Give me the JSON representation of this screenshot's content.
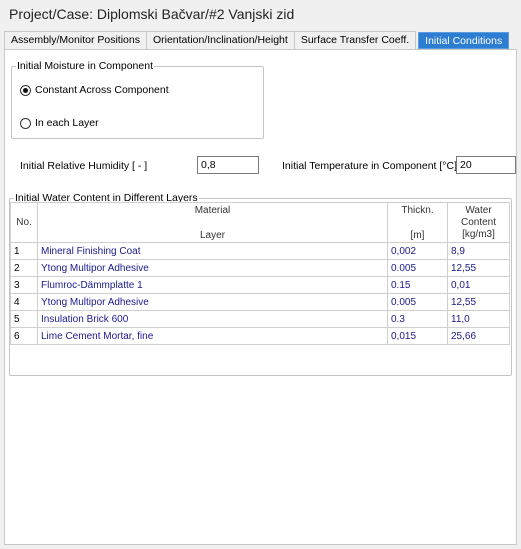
{
  "title": "Project/Case:  Diplomski Bačvar/#2 Vanjski zid",
  "tabs": [
    {
      "label": "Assembly/Monitor Positions",
      "active": false
    },
    {
      "label": "Orientation/Inclination/Height",
      "active": false
    },
    {
      "label": "Surface Transfer Coeff.",
      "active": false
    },
    {
      "label": "Initial Conditions",
      "active": true
    }
  ],
  "moisture_group": {
    "legend": "Initial Moisture in Component",
    "options": [
      {
        "label": "Constant Across Component",
        "checked": true
      },
      {
        "label": "In each Layer",
        "checked": false
      }
    ]
  },
  "fields": {
    "rh_label": "Initial Relative Humidity [ - ]",
    "rh_value": "0,8",
    "temp_label": "Initial Temperature in Component [°C]",
    "temp_value": "20"
  },
  "water_group": {
    "legend": "Initial Water Content in Different Layers",
    "headers": {
      "no": "No.",
      "material_top": "Material",
      "material_bottom": "Layer",
      "thickn_top": "Thickn.",
      "thickn_bottom": "[m]",
      "water_line1": "Water",
      "water_line2": "Content",
      "water_line3": "[kg/m3]"
    },
    "rows": [
      {
        "no": "1",
        "material": "Mineral Finishing Coat",
        "thickness": "0,002",
        "water": "8,9"
      },
      {
        "no": "2",
        "material": "Ytong Multipor Adhesive",
        "thickness": "0.005",
        "water": "12,55"
      },
      {
        "no": "3",
        "material": "Flumroc-Dämmplatte 1",
        "thickness": "0.15",
        "water": "0,01"
      },
      {
        "no": "4",
        "material": "Ytong Multipor Adhesive",
        "thickness": "0.005",
        "water": "12,55"
      },
      {
        "no": "5",
        "material": "Insulation Brick 600",
        "thickness": "0.3",
        "water": "11,0"
      },
      {
        "no": "6",
        "material": "Lime Cement Mortar, fine",
        "thickness": "0,015",
        "water": "25,66"
      }
    ]
  }
}
